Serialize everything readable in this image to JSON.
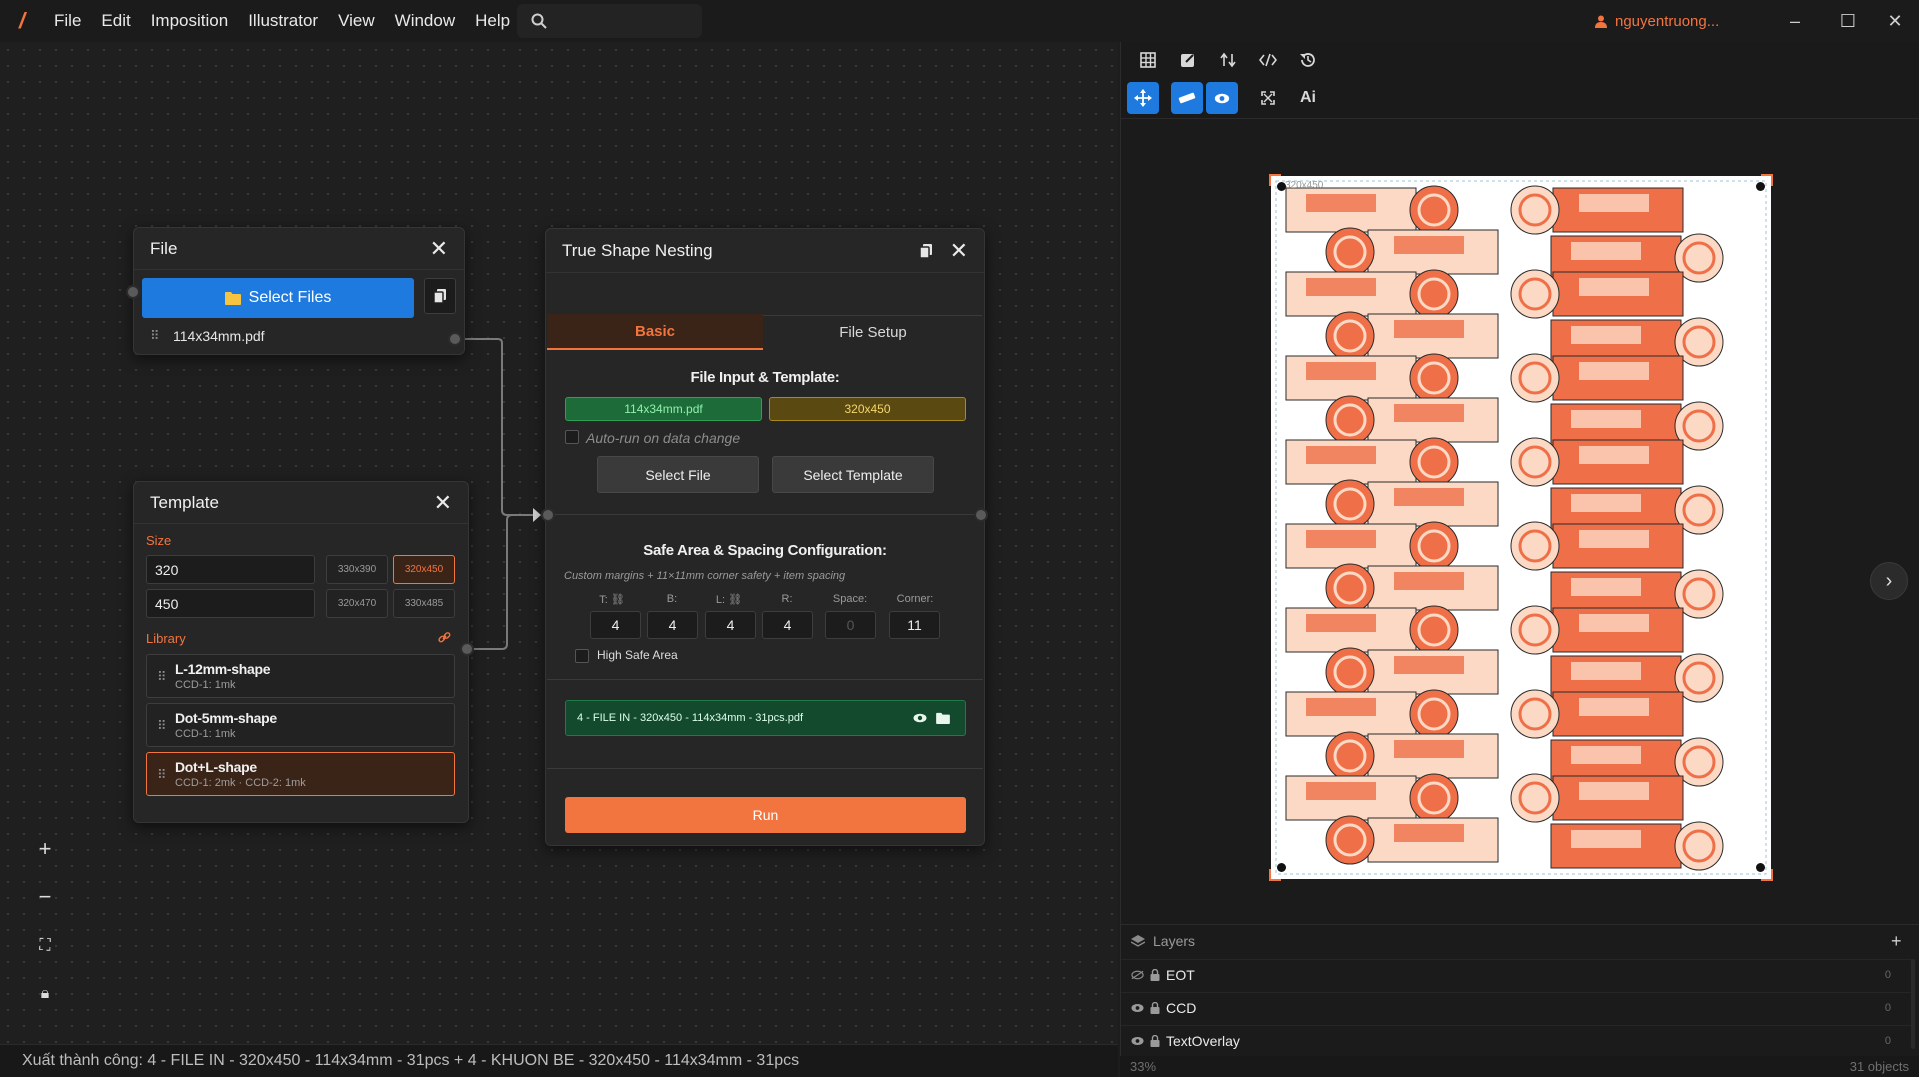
{
  "app": {
    "logo": "/",
    "accent": "#f2743f",
    "primary": "#1f7ae0"
  },
  "menu": [
    "File",
    "Edit",
    "Imposition",
    "Illustrator",
    "View",
    "Window",
    "Help"
  ],
  "user": {
    "name": "nguyentruong..."
  },
  "window_controls": {
    "minimize": "–",
    "maximize": "☐",
    "close": "✕"
  },
  "file_node": {
    "title": "File",
    "select_button": "Select Files",
    "file_name": "114x34mm.pdf"
  },
  "template_node": {
    "title": "Template",
    "size_label": "Size",
    "width": "320",
    "height": "450",
    "presets": [
      "330x390",
      "320x450",
      "320x470",
      "330x485"
    ],
    "active_preset": "320x450",
    "library_label": "Library",
    "library": [
      {
        "name": "L-12mm-shape",
        "sub": "CCD-1: 1mk"
      },
      {
        "name": "Dot-5mm-shape",
        "sub": "CCD-1: 1mk"
      },
      {
        "name": "Dot+L-shape",
        "sub": "CCD-1: 2mk · CCD-2: 1mk"
      }
    ]
  },
  "nesting_node": {
    "title": "True Shape Nesting",
    "tabs": [
      "Basic",
      "File Setup"
    ],
    "active_tab": "Basic",
    "file_input_title": "File Input & Template:",
    "file_badge": "114x34mm.pdf",
    "template_badge": "320x450",
    "auto_run_label": "Auto-run on data change",
    "select_file": "Select File",
    "select_template": "Select Template",
    "safe_title": "Safe Area & Spacing Configuration:",
    "safe_desc": "Custom margins + 11×11mm corner safety + item spacing",
    "fields": [
      {
        "label": "T:",
        "value": "4"
      },
      {
        "label": "B:",
        "value": "4"
      },
      {
        "label": "L:",
        "value": "4"
      },
      {
        "label": "R:",
        "value": "4"
      },
      {
        "label": "Space:",
        "value": "0"
      },
      {
        "label": "Corner:",
        "value": "11"
      }
    ],
    "high_safe_label": "High Safe Area",
    "output_file": "4 - FILE IN - 320x450 - 114x34mm - 31pcs.pdf",
    "run_label": "Run"
  },
  "preview": {
    "sheet_label": "320x450"
  },
  "layers": {
    "title": "Layers",
    "items": [
      {
        "name": "EOT",
        "count": "0"
      },
      {
        "name": "CCD",
        "count": "0"
      },
      {
        "name": "TextOverlay",
        "count": "0"
      }
    ]
  },
  "status": {
    "message": "Xuất thành công: 4 - FILE IN - 320x450 - 114x34mm - 31pcs + 4 - KHUON BE - 320x450 - 114x34mm - 31pcs"
  },
  "footer": {
    "zoom": "33%",
    "objects": "31 objects"
  }
}
